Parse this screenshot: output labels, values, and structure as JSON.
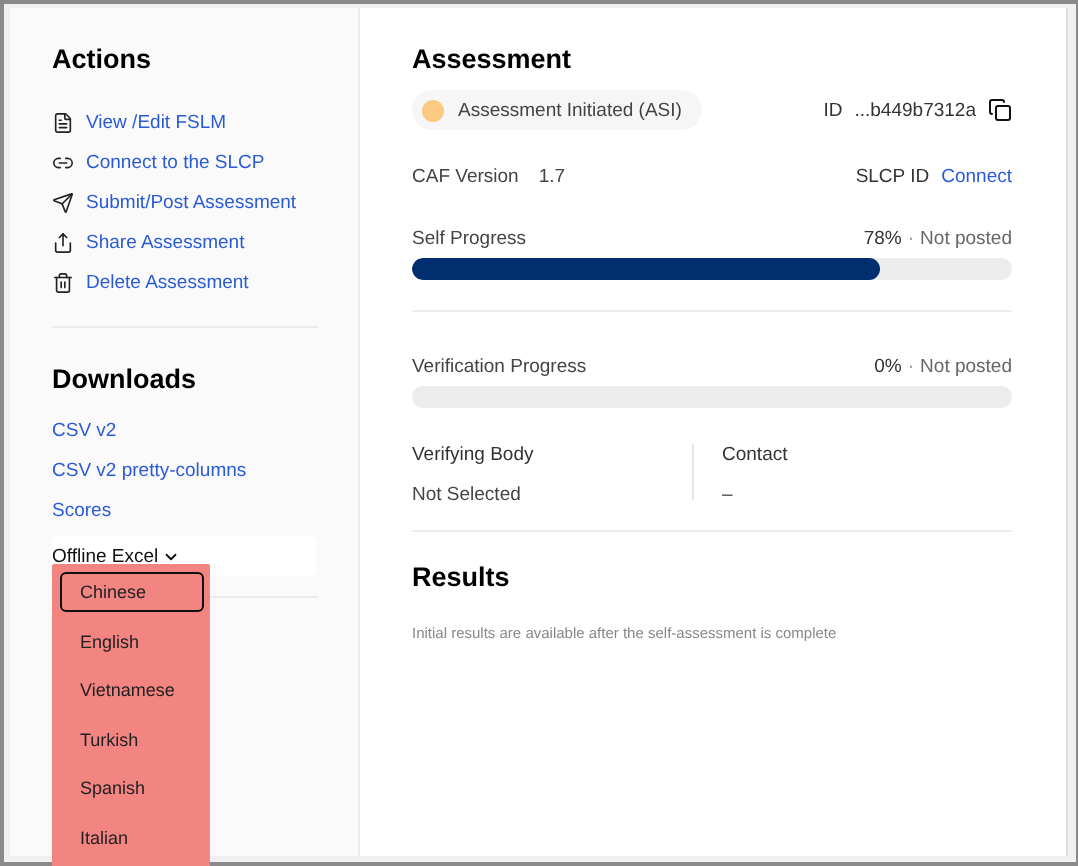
{
  "actions": {
    "title": "Actions",
    "items": [
      {
        "kind": "file",
        "label": "View /Edit FSLM"
      },
      {
        "kind": "link",
        "label": "Connect to the SLCP"
      },
      {
        "kind": "send",
        "label": "Submit/Post Assessment"
      },
      {
        "kind": "share",
        "label": "Share Assessment"
      },
      {
        "kind": "delete",
        "label": "Delete Assessment"
      }
    ]
  },
  "downloads": {
    "title": "Downloads",
    "links": [
      "CSV v2",
      "CSV v2 pretty-columns",
      "Scores"
    ],
    "dropdown": {
      "label": "Offline Excel",
      "expanded": true,
      "options": [
        {
          "label": "Chinese",
          "selected": true
        },
        {
          "label": "English",
          "selected": false
        },
        {
          "label": "Vietnamese",
          "selected": false
        },
        {
          "label": "Turkish",
          "selected": false
        },
        {
          "label": "Spanish",
          "selected": false
        },
        {
          "label": "Italian",
          "selected": false
        }
      ]
    }
  },
  "assessment": {
    "title": "Assessment",
    "status": {
      "label": "Assessment Initiated (ASI)",
      "color": "#fbc97f"
    },
    "id_label": "ID",
    "id_value": "...b449b7312a",
    "caf_label": "CAF Version",
    "caf_value": "1.7",
    "slcp_label": "SLCP ID",
    "slcp_link": "Connect",
    "progress": [
      {
        "label": "Self Progress",
        "percent": "78%",
        "separator": "·",
        "status": "Not posted",
        "level": 0.78
      },
      {
        "label": "Verification Progress",
        "percent": "0%",
        "separator": "·",
        "status": "Not posted"
      }
    ],
    "verifying_body_label": "Verifying Body",
    "verifying_body_value": "Not Selected",
    "contact_label": "Contact",
    "contact_value": "–"
  },
  "results": {
    "title": "Results",
    "note": "Initial results are available after the self-assessment is complete"
  }
}
